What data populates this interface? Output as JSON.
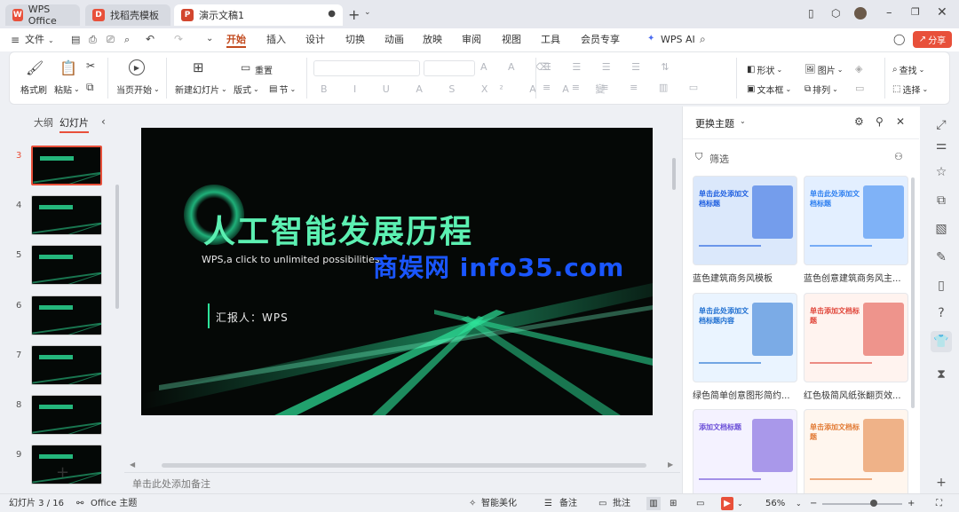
{
  "tabs": [
    {
      "label": "WPS Office"
    },
    {
      "label": "找稻壳模板"
    },
    {
      "label": "演示文稿1"
    }
  ],
  "menu": {
    "file": "文件",
    "items": [
      "开始",
      "插入",
      "设计",
      "切换",
      "动画",
      "放映",
      "审阅",
      "视图",
      "工具",
      "会员专享"
    ],
    "wps_ai": "WPS AI",
    "share": "分享"
  },
  "ribbon": {
    "format_painter": "格式刷",
    "paste": "粘贴",
    "play_current": "当页开始",
    "new_slide": "新建幻灯片",
    "layout": "版式",
    "section": "节",
    "reset": "重置",
    "shape": "形状",
    "picture": "图片",
    "textbox": "文本框",
    "arrange": "排列",
    "find": "查找",
    "select": "选择"
  },
  "left_panel": {
    "outline": "大纲",
    "slides": "幻灯片",
    "slide_numbers": [
      "3",
      "4",
      "5",
      "6",
      "7",
      "8",
      "9"
    ],
    "add_symbol": "+"
  },
  "slide": {
    "title": "人工智能发展历程",
    "subtitle": "WPS,a click to unlimited possibilities",
    "reporter": "汇报人：WPS"
  },
  "watermark": "商娱网 info35.com",
  "notes_placeholder": "单击此处添加备注",
  "right_panel": {
    "title": "更换主题",
    "filter": "筛选",
    "templates": [
      {
        "name": "蓝色建筑商务风模板",
        "headline": "单击此处添加文档标题"
      },
      {
        "name": "蓝色创意建筑商务风主...",
        "headline": "单击此处添加文档标题"
      },
      {
        "name": "绿色简单创意图形简约...",
        "headline": "单击此处添加文档标题内容"
      },
      {
        "name": "红色极简风纸张翻页效...",
        "headline": "单击添加文档标题"
      },
      {
        "name": "",
        "headline": "添加文档标题"
      },
      {
        "name": "",
        "headline": "单击添加文档标题"
      }
    ]
  },
  "status": {
    "slide_count": "幻灯片 3 / 16",
    "theme": "Office 主题",
    "beautify": "智能美化",
    "notes": "备注",
    "comments": "批注",
    "zoom": "56%"
  },
  "colors": {
    "accent": "#e8503a",
    "slide_green": "#2de39a",
    "active_tab": "#c24a1e"
  }
}
